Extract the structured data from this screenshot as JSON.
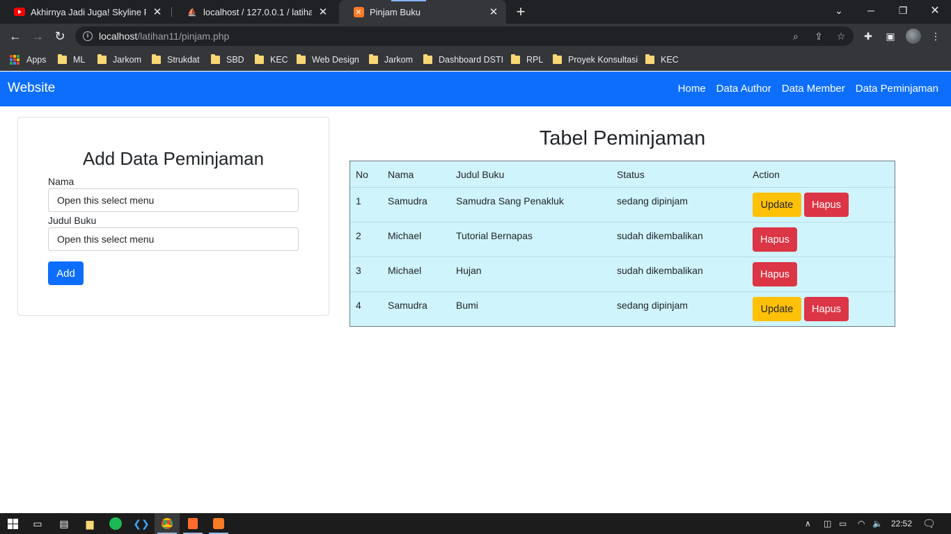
{
  "browser": {
    "tabs": [
      {
        "title": "Akhirnya Jadi Juga! Skyline R-34 |",
        "icon": "youtube-icon",
        "active": false
      },
      {
        "title": "localhost / 127.0.0.1 / latihan11 /",
        "icon": "phpmyadmin-icon",
        "active": false
      },
      {
        "title": "Pinjam Buku",
        "icon": "xampp-icon",
        "active": true
      }
    ],
    "url_host": "localhost",
    "url_path": "/latihan11/pinjam.php",
    "bookmarks": [
      "Apps",
      "ML",
      "Jarkom",
      "Strukdat",
      "SBD",
      "KEC",
      "Web Design",
      "Jarkom",
      "Dashboard DSTI",
      "RPL",
      "Proyek Konsultasi",
      "KEC"
    ]
  },
  "navbar": {
    "brand": "Website",
    "links": [
      "Home",
      "Data Author",
      "Data Member",
      "Data Peminjaman"
    ]
  },
  "form": {
    "title": "Add Data Peminjaman",
    "nama_label": "Nama",
    "nama_value": "Open this select menu",
    "judul_label": "Judul Buku",
    "judul_value": "Open this select menu",
    "add_label": "Add"
  },
  "table": {
    "title": "Tabel Peminjaman",
    "headers": [
      "No",
      "Nama",
      "Judul Buku",
      "Status",
      "Action"
    ],
    "rows": [
      {
        "no": "1",
        "nama": "Samudra",
        "judul": "Samudra Sang Penakluk",
        "status": "sedang dipinjam",
        "actions": [
          "Update",
          "Hapus"
        ]
      },
      {
        "no": "2",
        "nama": "Michael",
        "judul": "Tutorial Bernapas",
        "status": "sudah dikembalikan",
        "actions": [
          "Hapus"
        ]
      },
      {
        "no": "3",
        "nama": "Michael",
        "judul": "Hujan",
        "status": "sudah dikembalikan",
        "actions": [
          "Hapus"
        ]
      },
      {
        "no": "4",
        "nama": "Samudra",
        "judul": "Bumi",
        "status": "sedang dipinjam",
        "actions": [
          "Update",
          "Hapus"
        ]
      }
    ]
  },
  "taskbar": {
    "clock": "22:52"
  },
  "colors": {
    "primary": "#0d6efd",
    "warning": "#ffc107",
    "danger": "#dc3545",
    "table_info_bg": "#cff4fc"
  }
}
